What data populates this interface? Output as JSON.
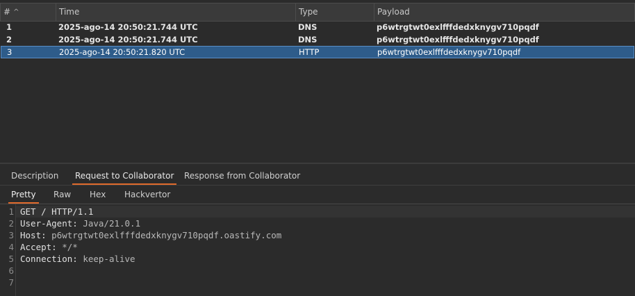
{
  "table": {
    "columns": {
      "num": "#",
      "time": "Time",
      "type": "Type",
      "payload": "Payload"
    },
    "sort_icon": "caret-up-icon",
    "rows": [
      {
        "num": "1",
        "time": "2025-ago-14 20:50:21.744 UTC",
        "type": "DNS",
        "payload": "p6wtrgtwt0exlfffdedxknygv710pqdf"
      },
      {
        "num": "2",
        "time": "2025-ago-14 20:50:21.744 UTC",
        "type": "DNS",
        "payload": "p6wtrgtwt0exlfffdedxknygv710pqdf"
      },
      {
        "num": "3",
        "time": "2025-ago-14 20:50:21.820 UTC",
        "type": "HTTP",
        "payload": "p6wtrgtwt0exlfffdedxknygv710pqdf"
      }
    ],
    "selected_row": 3
  },
  "detail_tabs": [
    {
      "label": "Description"
    },
    {
      "label": "Request to Collaborator"
    },
    {
      "label": "Response from Collaborator"
    }
  ],
  "sub_tabs": [
    {
      "label": "Pretty"
    },
    {
      "label": "Raw"
    },
    {
      "label": "Hex"
    },
    {
      "label": "Hackvertor"
    }
  ],
  "editor": {
    "line_numbers": [
      "1",
      "2",
      "3",
      "4",
      "5",
      "6",
      "7"
    ],
    "lines": [
      {
        "name": "GET / HTTP/1.1",
        "value": ""
      },
      {
        "name": "User-Agent:",
        "value": " Java/21.0.1"
      },
      {
        "name": "Host:",
        "value": " p6wtrgtwt0exlfffdedxknygv710pqdf.oastify.com"
      },
      {
        "name": "Accept:",
        "value": " */*"
      },
      {
        "name": "Connection:",
        "value": " keep-alive"
      },
      {
        "name": "",
        "value": ""
      },
      {
        "name": "",
        "value": ""
      }
    ]
  },
  "colors": {
    "accent": "#e06a2c",
    "selection": "#2e5c8a"
  }
}
